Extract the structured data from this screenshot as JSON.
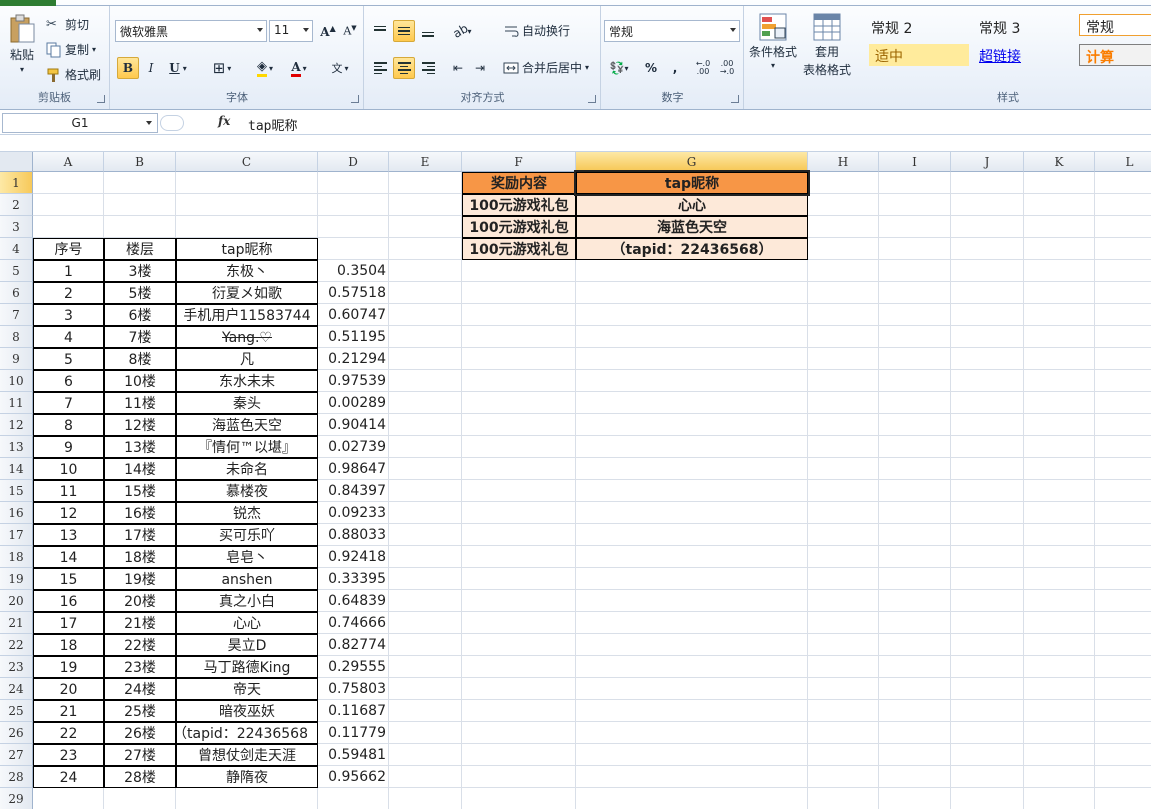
{
  "ribbon": {
    "clipboard": {
      "paste": "粘贴",
      "cut": "剪切",
      "copy": "复制",
      "format_painter": "格式刷",
      "label": "剪贴板"
    },
    "font": {
      "name": "微软雅黑",
      "size": "11",
      "bold": "B",
      "italic": "I",
      "underline": "U",
      "label": "字体"
    },
    "alignment": {
      "wrap": "自动换行",
      "merge": "合并后居中",
      "label": "对齐方式"
    },
    "number": {
      "format": "常规",
      "percent": "%",
      "comma": ",",
      "label": "数字"
    },
    "styles_group": {
      "conditional": "条件格式",
      "table_format_1": "套用",
      "table_format_2": "表格格式",
      "label": "样式"
    },
    "styles": [
      {
        "name": "常规 2"
      },
      {
        "name": "常规 3"
      },
      {
        "name": "常规"
      },
      {
        "name": "适中"
      },
      {
        "name": "超链接"
      },
      {
        "name": "计算"
      }
    ]
  },
  "formula_bar": {
    "name_box": "G1",
    "fx": "fx",
    "content": "tap昵称"
  },
  "columns": [
    "A",
    "B",
    "C",
    "D",
    "E",
    "F",
    "G",
    "H",
    "I",
    "J",
    "K",
    "L"
  ],
  "selected_column": "G",
  "rows": [
    "1",
    "2",
    "3",
    "4",
    "5",
    "6",
    "7",
    "8",
    "9",
    "10",
    "11",
    "12",
    "13",
    "14",
    "15",
    "16",
    "17",
    "18",
    "19",
    "20",
    "21",
    "22",
    "23",
    "24",
    "25",
    "26",
    "27",
    "28",
    "29"
  ],
  "table": {
    "headers": [
      "序号",
      "楼层",
      "tap昵称"
    ],
    "rows": [
      [
        "1",
        "3楼",
        "东极丶",
        "0.3504"
      ],
      [
        "2",
        "5楼",
        "衍夏メ如歌",
        "0.57518"
      ],
      [
        "3",
        "6楼",
        "手机用户11583744",
        "0.60747"
      ],
      [
        "4",
        "7楼",
        "Yang.♡",
        "0.51195"
      ],
      [
        "5",
        "8楼",
        "凡",
        "0.21294"
      ],
      [
        "6",
        "10楼",
        "东水未末",
        "0.97539"
      ],
      [
        "7",
        "11楼",
        "秦头",
        "0.00289"
      ],
      [
        "8",
        "12楼",
        "海蓝色天空",
        "0.90414"
      ],
      [
        "9",
        "13楼",
        "『情何™以堪』",
        "0.02739"
      ],
      [
        "10",
        "14楼",
        "未命名",
        "0.98647"
      ],
      [
        "11",
        "15楼",
        "慕楼夜",
        "0.84397"
      ],
      [
        "12",
        "16楼",
        "锐杰",
        "0.09233"
      ],
      [
        "13",
        "17楼",
        "买可乐吖",
        "0.88033"
      ],
      [
        "14",
        "18楼",
        "皂皂丶",
        "0.92418"
      ],
      [
        "15",
        "19楼",
        "anshen",
        "0.33395"
      ],
      [
        "16",
        "20楼",
        "真之小白",
        "0.64839"
      ],
      [
        "17",
        "21楼",
        "心心",
        "0.74666"
      ],
      [
        "18",
        "22楼",
        "昊立D",
        "0.82774"
      ],
      [
        "19",
        "23楼",
        "马丁路德King",
        "0.29555"
      ],
      [
        "20",
        "24楼",
        "帝天",
        "0.75803"
      ],
      [
        "21",
        "25楼",
        "暗夜巫妖",
        "0.11687"
      ],
      [
        "22",
        "26楼",
        "（tapid：22436568",
        "0.11779"
      ],
      [
        "23",
        "27楼",
        "曾想仗剑走天涯",
        "0.59481"
      ],
      [
        "24",
        "28楼",
        "静隋夜",
        "0.95662"
      ]
    ]
  },
  "rewards": {
    "headers": [
      "奖励内容",
      "tap昵称"
    ],
    "rows": [
      [
        "100元游戏礼包",
        "心心"
      ],
      [
        "100元游戏礼包",
        "海蓝色天空"
      ],
      [
        "100元游戏礼包",
        "（tapid：22436568）"
      ]
    ]
  }
}
